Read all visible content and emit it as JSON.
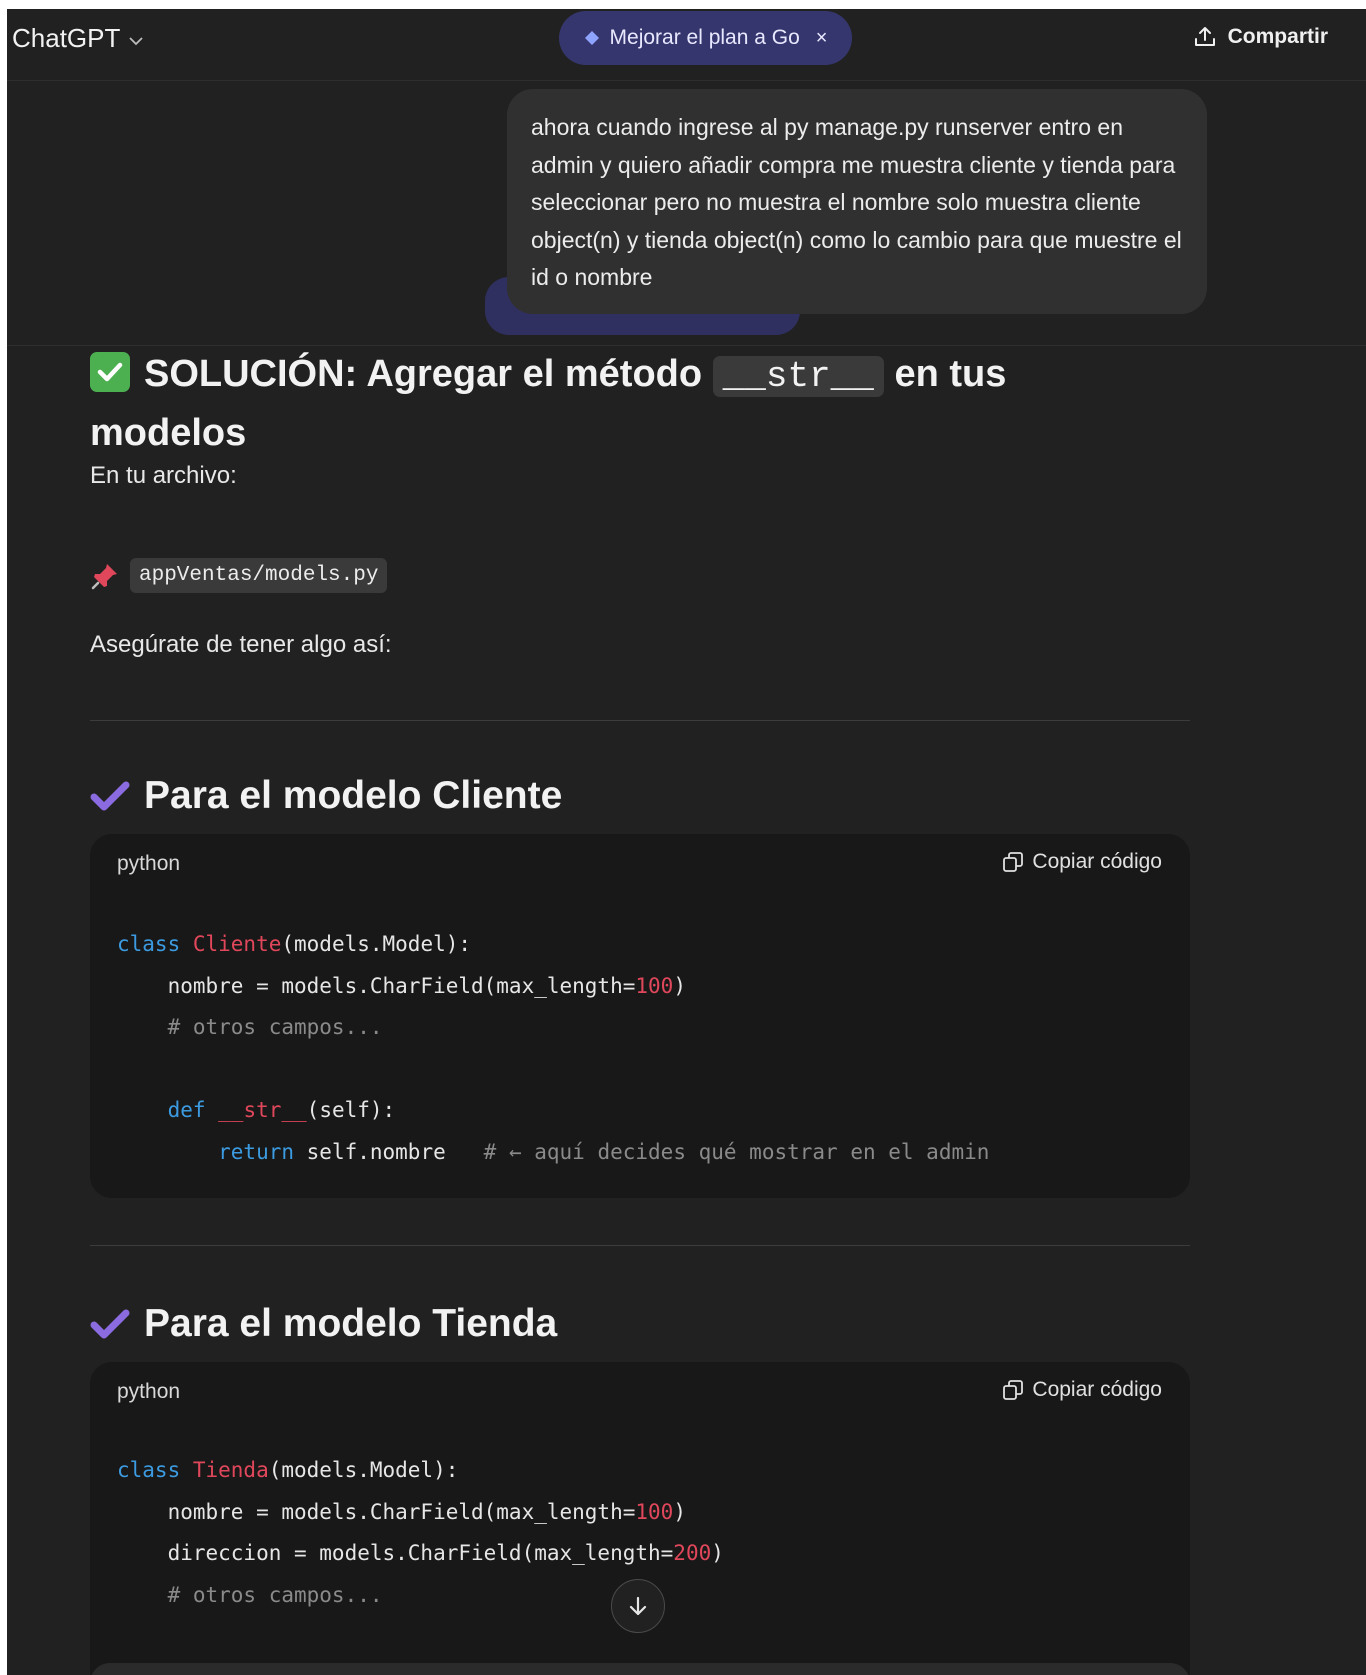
{
  "header": {
    "model_name": "ChatGPT",
    "upgrade_label": "Mejorar el plan a Go",
    "upgrade_close": "×",
    "share_label": "Compartir"
  },
  "user_message": {
    "text": "ahora cuando ingrese al py manage.py runserver entro en admin y quiero añadir compra me muestra cliente y tienda para seleccionar pero no muestra el nombre solo muestra cliente object(n) y tienda object(n) como lo cambio para que muestre el id o nombre"
  },
  "assistant": {
    "solution_title_pre": "SOLUCIÓN: Agregar el método",
    "solution_title_code": "__str__",
    "solution_title_post": "en tus modelos",
    "file_intro": "En tu archivo:",
    "file_path": "appVentas/models.py",
    "instruction": "Asegúrate de tener algo así:",
    "sections": [
      {
        "heading": "Para el modelo Cliente",
        "language": "python",
        "copy_label": "Copiar código",
        "code_lines": [
          [
            [
              "kw",
              "class "
            ],
            [
              "cls",
              "Cliente"
            ],
            [
              "t",
              "(models.Model):"
            ]
          ],
          [
            [
              "t",
              "    nombre = models.CharField(max_length="
            ],
            [
              "num",
              "100"
            ],
            [
              "t",
              ")"
            ]
          ],
          [
            [
              "cm",
              "    # otros campos..."
            ]
          ],
          [
            [
              "t",
              ""
            ]
          ],
          [
            [
              "kw",
              "    def "
            ],
            [
              "cls",
              "__str__"
            ],
            [
              "t",
              "(self):"
            ]
          ],
          [
            [
              "kw",
              "        return "
            ],
            [
              "t",
              "self.nombre   "
            ],
            [
              "cm",
              "# ← aquí decides qué mostrar en el admin"
            ]
          ]
        ]
      },
      {
        "heading": "Para el modelo Tienda",
        "language": "python",
        "copy_label": "Copiar código",
        "code_lines": [
          [
            [
              "kw",
              "class "
            ],
            [
              "cls",
              "Tienda"
            ],
            [
              "t",
              "(models.Model):"
            ]
          ],
          [
            [
              "t",
              "    nombre = models.CharField(max_length="
            ],
            [
              "num",
              "100"
            ],
            [
              "t",
              ")"
            ]
          ],
          [
            [
              "t",
              "    direccion = models.CharField(max_length="
            ],
            [
              "num",
              "200"
            ],
            [
              "t",
              ")"
            ]
          ],
          [
            [
              "cm",
              "    # otros campos..."
            ]
          ]
        ]
      }
    ]
  },
  "icons": {
    "model_dropdown": "chevron-down-icon",
    "upgrade": "diamond-icon",
    "share": "share-upload-icon",
    "solution": "check-box-icon",
    "file": "pushpin-icon",
    "section": "check-mark-icon",
    "copy": "copy-icon",
    "scroll": "arrow-down-icon"
  },
  "colors": {
    "background": "#212121",
    "code_background": "#181818",
    "keyword": "#3c9be0",
    "class_name": "#e0475b",
    "comment": "#8a8a8a",
    "upgrade_pill": "#36366e",
    "check_green": "#4caf50",
    "check_purple": "#8a6be0"
  }
}
